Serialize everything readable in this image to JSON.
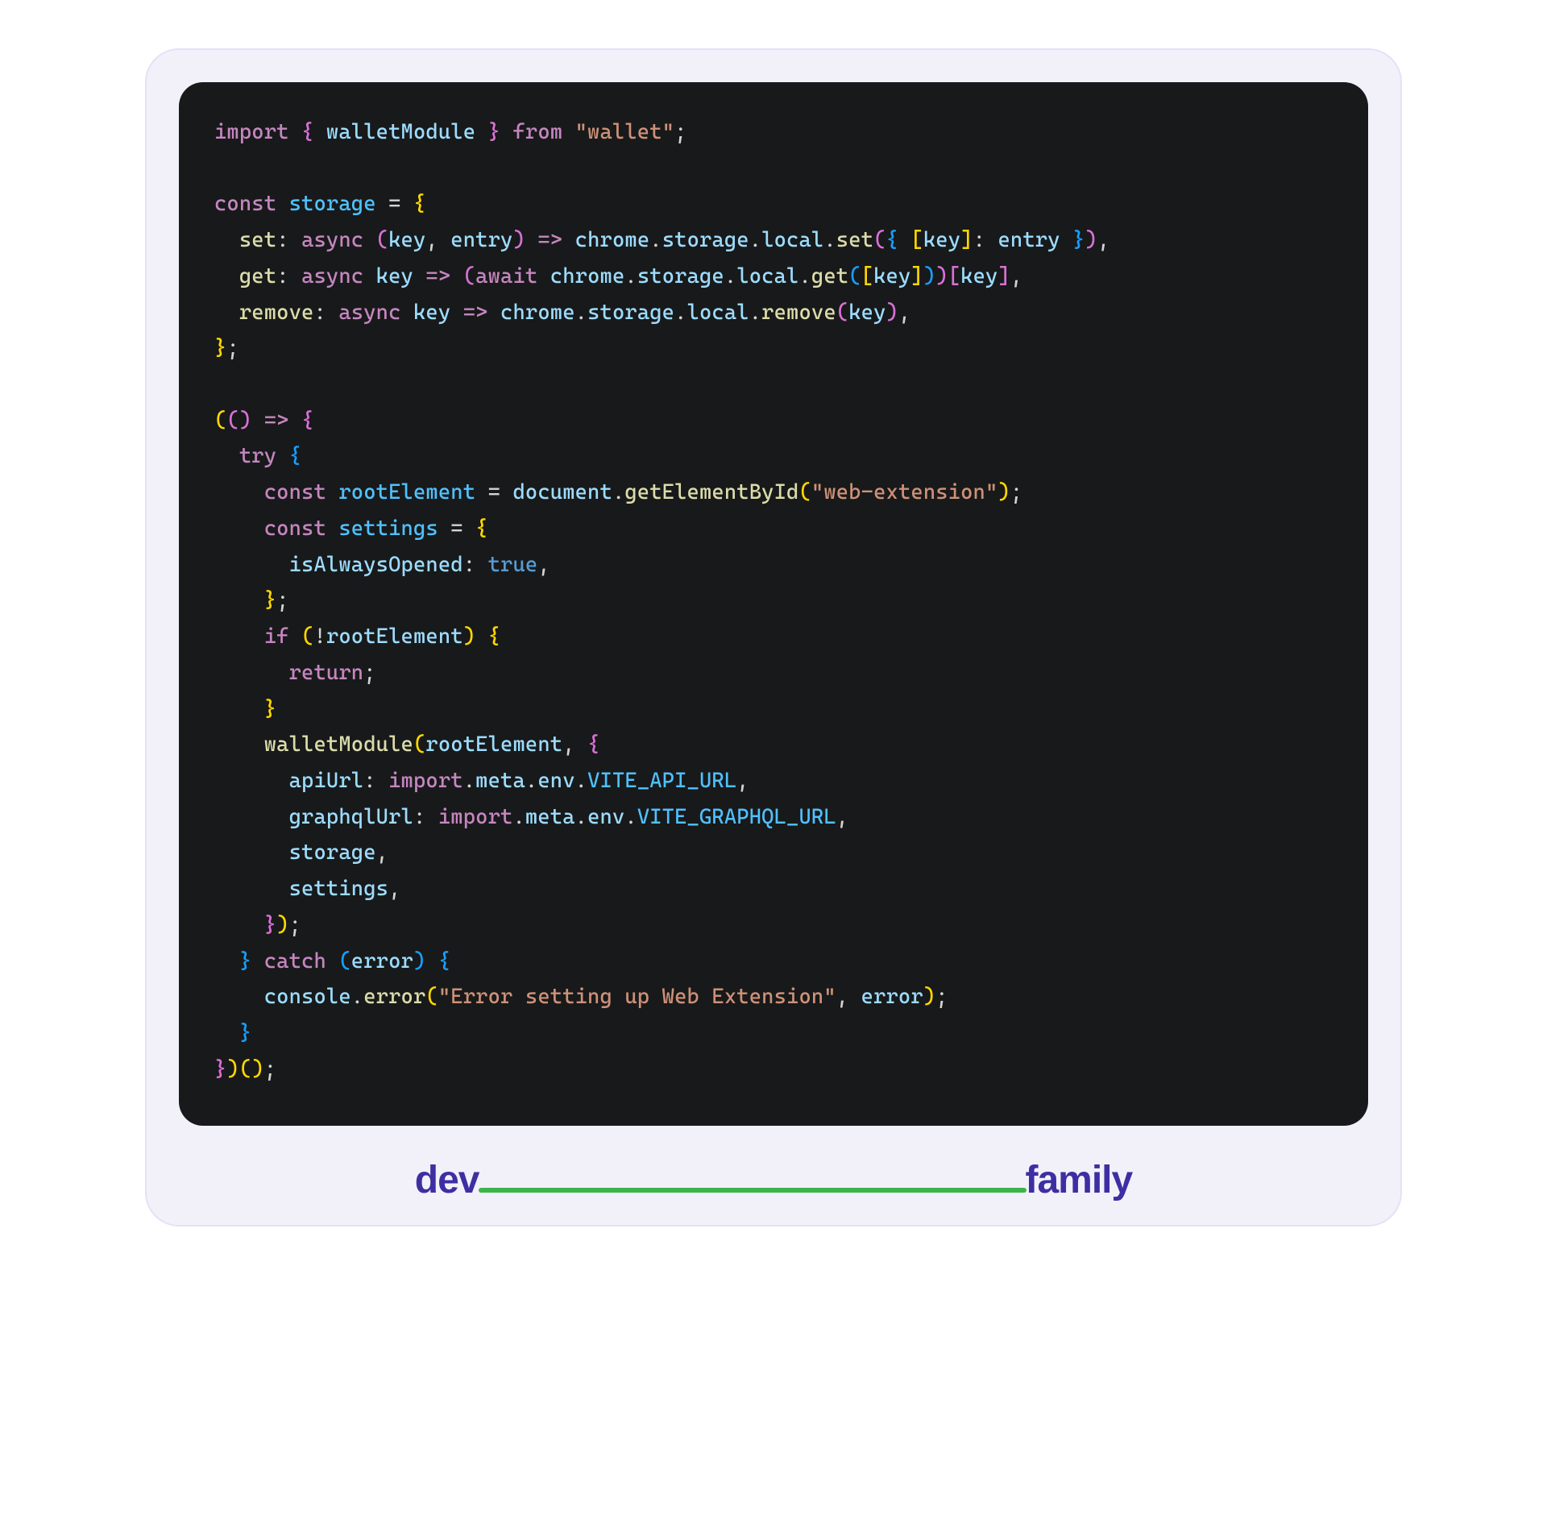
{
  "code": {
    "line1": {
      "t1": "import ",
      "t2": "{",
      "t3": " walletModule ",
      "t4": "}",
      "t5": " from ",
      "t6": "\"wallet\"",
      "t7": ";"
    },
    "line2": {
      "t1": ""
    },
    "line3": {
      "t1": "const ",
      "t2": "storage ",
      "t3": "= ",
      "t4": "{"
    },
    "line4": {
      "ind": "  ",
      "t1": "set",
      "t2": ": ",
      "t3": "async ",
      "t4": "(",
      "t5": "key",
      "t6": ", ",
      "t7": "entry",
      "t8": ")",
      "t9": " => ",
      "t10": "chrome",
      "t11": ".",
      "t12": "storage",
      "t13": ".",
      "t14": "local",
      "t15": ".",
      "t16": "set",
      "t17": "(",
      "t18": "{",
      "t19": " [",
      "t20": "key",
      "t21": "]",
      "t22": ": ",
      "t23": "entry",
      "t24": " }",
      "t25": ")",
      "t26": ","
    },
    "line5": {
      "ind": "  ",
      "t1": "get",
      "t2": ": ",
      "t3": "async ",
      "t4": "key",
      "t5": " => ",
      "t6": "(",
      "t7": "await ",
      "t8": "chrome",
      "t9": ".",
      "t10": "storage",
      "t11": ".",
      "t12": "local",
      "t13": ".",
      "t14": "get",
      "t15": "(",
      "t16": "[",
      "t17": "key",
      "t18": "]",
      "t19": ")",
      "t20": ")",
      "t21": "[",
      "t22": "key",
      "t23": "]",
      "t24": ","
    },
    "line6": {
      "ind": "  ",
      "t1": "remove",
      "t2": ": ",
      "t3": "async ",
      "t4": "key",
      "t5": " => ",
      "t6": "chrome",
      "t7": ".",
      "t8": "storage",
      "t9": ".",
      "t10": "local",
      "t11": ".",
      "t12": "remove",
      "t13": "(",
      "t14": "key",
      "t15": ")",
      "t16": ","
    },
    "line7": {
      "t1": "}",
      "t2": ";"
    },
    "line8": {
      "t1": ""
    },
    "line9": {
      "t1": "(",
      "t2": "(",
      "t3": ")",
      "t4": " => ",
      "t5": "{"
    },
    "line10": {
      "ind": "  ",
      "t1": "try ",
      "t2": "{"
    },
    "line11": {
      "ind": "    ",
      "t1": "const ",
      "t2": "rootElement ",
      "t3": "= ",
      "t4": "document",
      "t5": ".",
      "t6": "getElementById",
      "t7": "(",
      "t8": "\"web-extension\"",
      "t9": ")",
      "t10": ";"
    },
    "line12": {
      "ind": "    ",
      "t1": "const ",
      "t2": "settings ",
      "t3": "= ",
      "t4": "{"
    },
    "line13": {
      "ind": "      ",
      "t1": "isAlwaysOpened",
      "t2": ": ",
      "t3": "true",
      "t4": ","
    },
    "line14": {
      "ind": "    ",
      "t1": "}",
      "t2": ";"
    },
    "line15": {
      "ind": "    ",
      "t1": "if ",
      "t2": "(",
      "t3": "!",
      "t4": "rootElement",
      "t5": ")",
      "t6": " {"
    },
    "line16": {
      "ind": "      ",
      "t1": "return",
      "t2": ";"
    },
    "line17": {
      "ind": "    ",
      "t1": "}"
    },
    "line18": {
      "ind": "    ",
      "t1": "walletModule",
      "t2": "(",
      "t3": "rootElement",
      "t4": ", ",
      "t5": "{"
    },
    "line19": {
      "ind": "      ",
      "t1": "apiUrl",
      "t2": ": ",
      "t3": "import",
      "t4": ".",
      "t5": "meta",
      "t6": ".",
      "t7": "env",
      "t8": ".",
      "t9": "VITE_API_URL",
      "t10": ","
    },
    "line20": {
      "ind": "      ",
      "t1": "graphqlUrl",
      "t2": ": ",
      "t3": "import",
      "t4": ".",
      "t5": "meta",
      "t6": ".",
      "t7": "env",
      "t8": ".",
      "t9": "VITE_GRAPHQL_URL",
      "t10": ","
    },
    "line21": {
      "ind": "      ",
      "t1": "storage",
      "t2": ","
    },
    "line22": {
      "ind": "      ",
      "t1": "settings",
      "t2": ","
    },
    "line23": {
      "ind": "    ",
      "t1": "}",
      "t2": ")",
      "t3": ";"
    },
    "line24": {
      "ind": "  ",
      "t1": "}",
      "t2": " catch ",
      "t3": "(",
      "t4": "error",
      "t5": ")",
      "t6": " {"
    },
    "line25": {
      "ind": "    ",
      "t1": "console",
      "t2": ".",
      "t3": "error",
      "t4": "(",
      "t5": "\"Error setting up Web Extension\"",
      "t6": ", ",
      "t7": "error",
      "t8": ")",
      "t9": ";"
    },
    "line26": {
      "ind": "  ",
      "t1": "}"
    },
    "line27": {
      "t1": "}",
      "t2": ")",
      "t3": "(",
      "t4": ")",
      "t5": ";"
    }
  },
  "logo": {
    "left": "dev",
    "right": "family"
  }
}
